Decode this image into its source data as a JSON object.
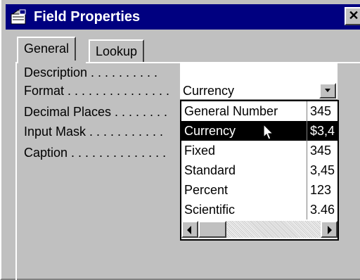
{
  "window": {
    "title": "Field Properties",
    "close_glyph": "✕",
    "title_icon": "properties-icon"
  },
  "tabs": [
    {
      "label": "General",
      "active": true
    },
    {
      "label": "Lookup",
      "active": false
    }
  ],
  "properties": [
    {
      "label": "Description . . . . . . . . . .",
      "value": ""
    },
    {
      "label": "Format . . . . . . . . . . . . . . .",
      "value": "Currency"
    },
    {
      "label": "Decimal Places . . . . . . . .",
      "value": ""
    },
    {
      "label": "Input Mask . . . . . . . . . . .",
      "value": ""
    },
    {
      "label": "Caption . . . . . . . . . . . . . .",
      "value": ""
    }
  ],
  "format_dropdown": {
    "options": [
      {
        "name": "General Number",
        "sample": "345"
      },
      {
        "name": "Currency",
        "sample": "$3,4"
      },
      {
        "name": "Fixed",
        "sample": "345"
      },
      {
        "name": "Standard",
        "sample": "3,45"
      },
      {
        "name": "Percent",
        "sample": "123"
      },
      {
        "name": "Scientific",
        "sample": "3.46"
      }
    ],
    "selected_index": 1
  },
  "colors": {
    "titlebar": "#000080",
    "face": "#c0c0c0",
    "selection": "#000000"
  }
}
